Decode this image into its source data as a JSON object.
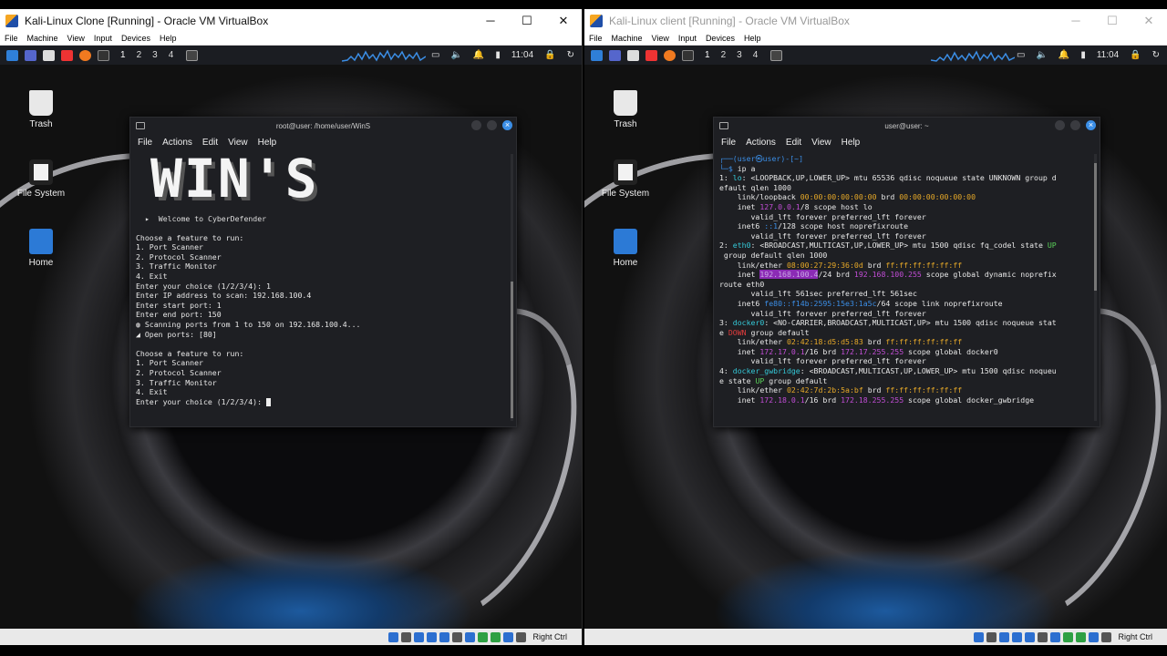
{
  "left_vm": {
    "title": "Kali-Linux Clone [Running] - Oracle VM VirtualBox",
    "menu": [
      "File",
      "Machine",
      "View",
      "Input",
      "Devices",
      "Help"
    ],
    "workspaces": [
      "1",
      "2",
      "3",
      "4"
    ],
    "clock": "11:04",
    "desktop_icons": [
      "Trash",
      "File System",
      "Home"
    ],
    "terminal": {
      "title": "root@user: /home/user/WinS",
      "menu": [
        "File",
        "Actions",
        "Edit",
        "View",
        "Help"
      ],
      "banner": "WIN'S",
      "welcome": "Welcome to CyberDefender",
      "lines": [
        "Choose a feature to run:",
        "1. Port Scanner",
        "2. Protocol Scanner",
        "3. Traffic Monitor",
        "4. Exit",
        "Enter your choice (1/2/3/4): 1",
        "Enter IP address to scan: 192.168.100.4",
        "Enter start port: 1",
        "Enter end port: 150",
        "Scanning ports from 1 to 150 on 192.168.100.4...",
        "Open ports: [80]",
        "",
        "Choose a feature to run:",
        "1. Port Scanner",
        "2. Protocol Scanner",
        "3. Traffic Monitor",
        "4. Exit"
      ],
      "prompt": "Enter your choice (1/2/3/4): "
    },
    "status_label": "Right Ctrl"
  },
  "right_vm": {
    "title": "Kali-Linux client [Running] - Oracle VM VirtualBox",
    "menu": [
      "File",
      "Machine",
      "View",
      "Input",
      "Devices",
      "Help"
    ],
    "workspaces": [
      "1",
      "2",
      "3",
      "4"
    ],
    "clock": "11:04",
    "desktop_icons": [
      "Trash",
      "File System",
      "Home"
    ],
    "terminal": {
      "title": "user@user: ~",
      "menu": [
        "File",
        "Actions",
        "Edit",
        "View",
        "Help"
      ],
      "prompt_user": "(user㉿user)-[~]",
      "command": "ip a"
    },
    "status_label": "Right Ctrl"
  },
  "colors": {
    "accent": "#3b8ee6",
    "warning": "#e7a928",
    "purple": "#c24dd6",
    "error": "#e23c3c"
  }
}
